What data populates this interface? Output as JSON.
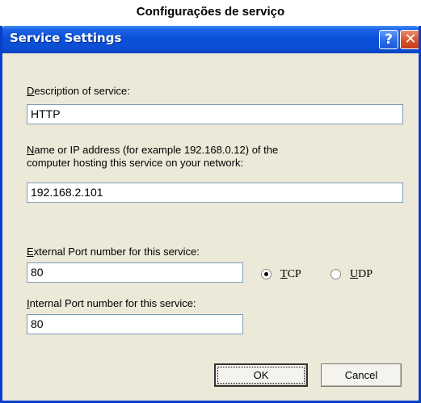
{
  "caption": "Configurações de serviço",
  "window": {
    "title": "Service Settings",
    "help_glyph": "?",
    "close_glyph": "✕"
  },
  "description": {
    "label_accel": "D",
    "label_rest": "escription of service:",
    "value": "HTTP"
  },
  "host": {
    "label_accel": "N",
    "label_line1_rest": "ame or IP address (for example 192.168.0.12) of the",
    "label_line2": "computer hosting this service on your network:",
    "value": "192.168.2.101"
  },
  "external_port": {
    "label_accel": "E",
    "label_rest": "xternal Port number for this service:",
    "value": "80"
  },
  "internal_port": {
    "label_accel": "I",
    "label_rest": "nternal Port number for this service:",
    "value": "80"
  },
  "protocol": {
    "tcp_accel": "T",
    "tcp_rest": "CP",
    "udp_accel": "U",
    "udp_rest": "DP",
    "selected": "TCP"
  },
  "buttons": {
    "ok": "OK",
    "cancel": "Cancel"
  }
}
